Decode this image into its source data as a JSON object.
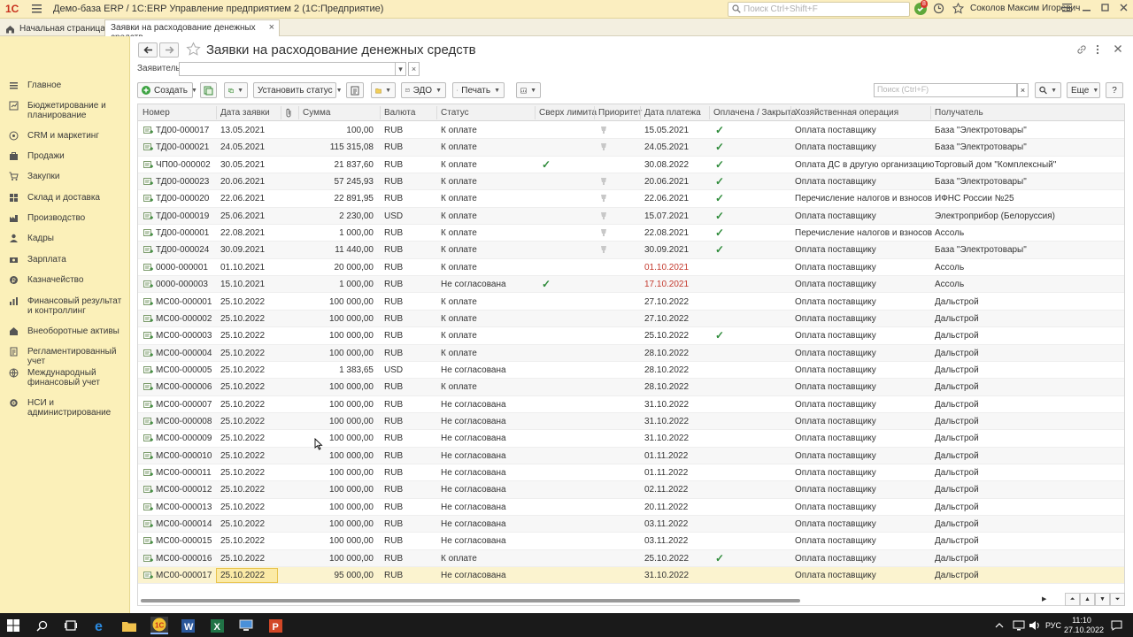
{
  "window": {
    "title": "Демо-база ERP / 1С:ERP Управление предприятием 2  (1С:Предприятие)",
    "logo_text": "1С",
    "search_placeholder": "Поиск Ctrl+Shift+F",
    "notification_count": "8",
    "user": "Соколов Максим Игоревич"
  },
  "tabs": {
    "home": "Начальная страница",
    "active": "Заявки на расходование денежных средств"
  },
  "sidebar": {
    "items": [
      {
        "label": "Главное",
        "icon": "menu-lines-icon"
      },
      {
        "label": "Бюджетирование и планирование",
        "icon": "budget-icon"
      },
      {
        "label": "CRM и маркетинг",
        "icon": "crm-icon"
      },
      {
        "label": "Продажи",
        "icon": "sales-icon"
      },
      {
        "label": "Закупки",
        "icon": "cart-icon"
      },
      {
        "label": "Склад и доставка",
        "icon": "warehouse-icon"
      },
      {
        "label": "Производство",
        "icon": "production-icon"
      },
      {
        "label": "Кадры",
        "icon": "people-icon"
      },
      {
        "label": "Зарплата",
        "icon": "salary-icon"
      },
      {
        "label": "Казначейство",
        "icon": "treasury-icon"
      },
      {
        "label": "Финансовый результат и контроллинг",
        "icon": "finance-icon"
      },
      {
        "label": "Внеоборотные активы",
        "icon": "assets-icon"
      },
      {
        "label": "Регламентированный учет",
        "icon": "accounting-icon"
      },
      {
        "label": "Международный финансовый учет",
        "icon": "intl-icon"
      },
      {
        "label": "НСИ и администрирование",
        "icon": "gear-icon"
      }
    ]
  },
  "form": {
    "title": "Заявки на расходование денежных средств",
    "applicant_label": "Заявитель:",
    "applicant_value": ""
  },
  "toolbar": {
    "create": "Создать",
    "set_status": "Установить статус",
    "edo": "ЭДО",
    "print": "Печать",
    "list_search_placeholder": "Поиск (Ctrl+F)",
    "more": "Еще",
    "help": "?"
  },
  "table": {
    "columns": [
      "Номер",
      "Дата заявки",
      "",
      "Сумма",
      "Валюта",
      "Статус",
      "Сверх лимита",
      "Приоритет",
      "Дата платежа",
      "Оплачена / Закрыта",
      "Хозяйственная операция",
      "Получатель"
    ],
    "rows": [
      {
        "num": "ТД00-000017",
        "date": "13.05.2021",
        "sum": "100,00",
        "cur": "RUB",
        "status": "К оплате",
        "over": false,
        "prio": true,
        "pay": "15.05.2021",
        "red": false,
        "paid": true,
        "op": "Оплата поставщику",
        "rcpt": "База \"Электротовары\""
      },
      {
        "num": "ТД00-000021",
        "date": "24.05.2021",
        "sum": "115 315,08",
        "cur": "RUB",
        "status": "К оплате",
        "over": false,
        "prio": true,
        "pay": "24.05.2021",
        "red": false,
        "paid": true,
        "op": "Оплата поставщику",
        "rcpt": "База \"Электротовары\""
      },
      {
        "num": "ЧП00-000002",
        "date": "30.05.2021",
        "sum": "21 837,60",
        "cur": "RUB",
        "status": "К оплате",
        "over": true,
        "prio": false,
        "pay": "30.08.2022",
        "red": false,
        "paid": true,
        "op": "Оплата ДС в другую организацию",
        "rcpt": "Торговый дом \"Комплексный\""
      },
      {
        "num": "ТД00-000023",
        "date": "20.06.2021",
        "sum": "57 245,93",
        "cur": "RUB",
        "status": "К оплате",
        "over": false,
        "prio": true,
        "pay": "20.06.2021",
        "red": false,
        "paid": true,
        "op": "Оплата поставщику",
        "rcpt": "База \"Электротовары\""
      },
      {
        "num": "ТД00-000020",
        "date": "22.06.2021",
        "sum": "22 891,95",
        "cur": "RUB",
        "status": "К оплате",
        "over": false,
        "prio": true,
        "pay": "22.06.2021",
        "red": false,
        "paid": true,
        "op": "Перечисление налогов и взносов",
        "rcpt": "ИФНС России №25"
      },
      {
        "num": "ТД00-000019",
        "date": "25.06.2021",
        "sum": "2 230,00",
        "cur": "USD",
        "status": "К оплате",
        "over": false,
        "prio": true,
        "pay": "15.07.2021",
        "red": false,
        "paid": true,
        "op": "Оплата поставщику",
        "rcpt": "Электроприбор (Белоруссия)"
      },
      {
        "num": "ТД00-000001",
        "date": "22.08.2021",
        "sum": "1 000,00",
        "cur": "RUB",
        "status": "К оплате",
        "over": false,
        "prio": true,
        "pay": "22.08.2021",
        "red": false,
        "paid": true,
        "op": "Перечисление налогов и взносов",
        "rcpt": "Ассоль"
      },
      {
        "num": "ТД00-000024",
        "date": "30.09.2021",
        "sum": "11 440,00",
        "cur": "RUB",
        "status": "К оплате",
        "over": false,
        "prio": true,
        "pay": "30.09.2021",
        "red": false,
        "paid": true,
        "op": "Оплата поставщику",
        "rcpt": "База \"Электротовары\""
      },
      {
        "num": "0000-000001",
        "date": "01.10.2021",
        "sum": "20 000,00",
        "cur": "RUB",
        "status": "К оплате",
        "over": false,
        "prio": false,
        "pay": "01.10.2021",
        "red": true,
        "paid": false,
        "op": "Оплата поставщику",
        "rcpt": "Ассоль"
      },
      {
        "num": "0000-000003",
        "date": "15.10.2021",
        "sum": "1 000,00",
        "cur": "RUB",
        "status": "Не согласована",
        "over": true,
        "prio": false,
        "pay": "17.10.2021",
        "red": true,
        "paid": false,
        "op": "Оплата поставщику",
        "rcpt": "Ассоль"
      },
      {
        "num": "МС00-000001",
        "date": "25.10.2022",
        "sum": "100 000,00",
        "cur": "RUB",
        "status": "К оплате",
        "over": false,
        "prio": false,
        "pay": "27.10.2022",
        "red": false,
        "paid": false,
        "op": "Оплата поставщику",
        "rcpt": "Дальстрой"
      },
      {
        "num": "МС00-000002",
        "date": "25.10.2022",
        "sum": "100 000,00",
        "cur": "RUB",
        "status": "К оплате",
        "over": false,
        "prio": false,
        "pay": "27.10.2022",
        "red": false,
        "paid": false,
        "op": "Оплата поставщику",
        "rcpt": "Дальстрой"
      },
      {
        "num": "МС00-000003",
        "date": "25.10.2022",
        "sum": "100 000,00",
        "cur": "RUB",
        "status": "К оплате",
        "over": false,
        "prio": false,
        "pay": "25.10.2022",
        "red": false,
        "paid": true,
        "op": "Оплата поставщику",
        "rcpt": "Дальстрой"
      },
      {
        "num": "МС00-000004",
        "date": "25.10.2022",
        "sum": "100 000,00",
        "cur": "RUB",
        "status": "К оплате",
        "over": false,
        "prio": false,
        "pay": "28.10.2022",
        "red": false,
        "paid": false,
        "op": "Оплата поставщику",
        "rcpt": "Дальстрой"
      },
      {
        "num": "МС00-000005",
        "date": "25.10.2022",
        "sum": "1 383,65",
        "cur": "USD",
        "status": "Не согласована",
        "over": false,
        "prio": false,
        "pay": "28.10.2022",
        "red": false,
        "paid": false,
        "op": "Оплата поставщику",
        "rcpt": "Дальстрой"
      },
      {
        "num": "МС00-000006",
        "date": "25.10.2022",
        "sum": "100 000,00",
        "cur": "RUB",
        "status": "К оплате",
        "over": false,
        "prio": false,
        "pay": "28.10.2022",
        "red": false,
        "paid": false,
        "op": "Оплата поставщику",
        "rcpt": "Дальстрой"
      },
      {
        "num": "МС00-000007",
        "date": "25.10.2022",
        "sum": "100 000,00",
        "cur": "RUB",
        "status": "Не согласована",
        "over": false,
        "prio": false,
        "pay": "31.10.2022",
        "red": false,
        "paid": false,
        "op": "Оплата поставщику",
        "rcpt": "Дальстрой"
      },
      {
        "num": "МС00-000008",
        "date": "25.10.2022",
        "sum": "100 000,00",
        "cur": "RUB",
        "status": "Не согласована",
        "over": false,
        "prio": false,
        "pay": "31.10.2022",
        "red": false,
        "paid": false,
        "op": "Оплата поставщику",
        "rcpt": "Дальстрой"
      },
      {
        "num": "МС00-000009",
        "date": "25.10.2022",
        "sum": "100 000,00",
        "cur": "RUB",
        "status": "Не согласована",
        "over": false,
        "prio": false,
        "pay": "31.10.2022",
        "red": false,
        "paid": false,
        "op": "Оплата поставщику",
        "rcpt": "Дальстрой"
      },
      {
        "num": "МС00-000010",
        "date": "25.10.2022",
        "sum": "100 000,00",
        "cur": "RUB",
        "status": "Не согласована",
        "over": false,
        "prio": false,
        "pay": "01.11.2022",
        "red": false,
        "paid": false,
        "op": "Оплата поставщику",
        "rcpt": "Дальстрой"
      },
      {
        "num": "МС00-000011",
        "date": "25.10.2022",
        "sum": "100 000,00",
        "cur": "RUB",
        "status": "Не согласована",
        "over": false,
        "prio": false,
        "pay": "01.11.2022",
        "red": false,
        "paid": false,
        "op": "Оплата поставщику",
        "rcpt": "Дальстрой"
      },
      {
        "num": "МС00-000012",
        "date": "25.10.2022",
        "sum": "100 000,00",
        "cur": "RUB",
        "status": "Не согласована",
        "over": false,
        "prio": false,
        "pay": "02.11.2022",
        "red": false,
        "paid": false,
        "op": "Оплата поставщику",
        "rcpt": "Дальстрой"
      },
      {
        "num": "МС00-000013",
        "date": "25.10.2022",
        "sum": "100 000,00",
        "cur": "RUB",
        "status": "Не согласована",
        "over": false,
        "prio": false,
        "pay": "20.11.2022",
        "red": false,
        "paid": false,
        "op": "Оплата поставщику",
        "rcpt": "Дальстрой"
      },
      {
        "num": "МС00-000014",
        "date": "25.10.2022",
        "sum": "100 000,00",
        "cur": "RUB",
        "status": "Не согласована",
        "over": false,
        "prio": false,
        "pay": "03.11.2022",
        "red": false,
        "paid": false,
        "op": "Оплата поставщику",
        "rcpt": "Дальстрой"
      },
      {
        "num": "МС00-000015",
        "date": "25.10.2022",
        "sum": "100 000,00",
        "cur": "RUB",
        "status": "Не согласована",
        "over": false,
        "prio": false,
        "pay": "03.11.2022",
        "red": false,
        "paid": false,
        "op": "Оплата поставщику",
        "rcpt": "Дальстрой"
      },
      {
        "num": "МС00-000016",
        "date": "25.10.2022",
        "sum": "100 000,00",
        "cur": "RUB",
        "status": "К оплате",
        "over": false,
        "prio": false,
        "pay": "25.10.2022",
        "red": false,
        "paid": true,
        "op": "Оплата поставщику",
        "rcpt": "Дальстрой"
      },
      {
        "num": "МС00-000017",
        "date": "25.10.2022",
        "sum": "95 000,00",
        "cur": "RUB",
        "status": "Не согласована",
        "over": false,
        "prio": false,
        "pay": "31.10.2022",
        "red": false,
        "paid": false,
        "op": "Оплата поставщику",
        "rcpt": "Дальстрой"
      }
    ]
  },
  "taskbar": {
    "lang": "РУС",
    "time": "11:10",
    "date": "27.10.2022"
  },
  "colors": {
    "titlebar": "#fbeec0",
    "sidebar": "#fbf0b9",
    "check": "#2e8b3a",
    "overdue": "#c43a2e",
    "selected_row": "#fbf3cf"
  }
}
